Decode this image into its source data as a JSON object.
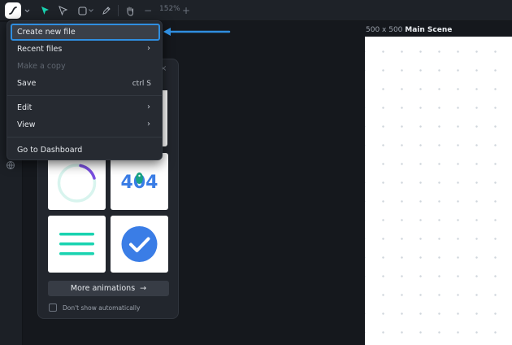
{
  "toolbar": {
    "tools": [
      "logo-icon",
      "chevron-down-icon",
      "select-arrow-icon",
      "direct-select-icon",
      "rectangle-icon",
      "chevron-down-icon",
      "pen-icon",
      "hand-icon"
    ],
    "zoom_out": "−",
    "zoom_level": "152%",
    "zoom_in": "+"
  },
  "canvas": {
    "size": "500 x 500",
    "name": "Main Scene",
    "background": "#ffffff"
  },
  "menu": {
    "items": [
      {
        "label": "Create new file",
        "state": "highlighted"
      },
      {
        "label": "Recent files",
        "submenu": "›"
      },
      {
        "label": "Make a copy",
        "state": "disabled"
      },
      {
        "label": "Save",
        "shortcut": "ctrl S"
      },
      {
        "label": "Edit",
        "submenu": "›"
      },
      {
        "label": "View",
        "submenu": "›"
      },
      {
        "label": "Go to Dashboard"
      }
    ]
  },
  "welcome_panel": {
    "close": "×",
    "tiles": [
      "loading-ring-animation",
      "404-animation",
      "menu-lines-animation",
      "check-circle-animation"
    ],
    "tile_404_text": "404",
    "more_button": "More animations",
    "more_button_arrow": "→",
    "dont_show_label": "Don't show automatically"
  },
  "colors": {
    "accent_blue": "#2f8ee0",
    "teal": "#19d3b0",
    "check_blue": "#3a7de6",
    "purple": "#7a4ee0"
  }
}
